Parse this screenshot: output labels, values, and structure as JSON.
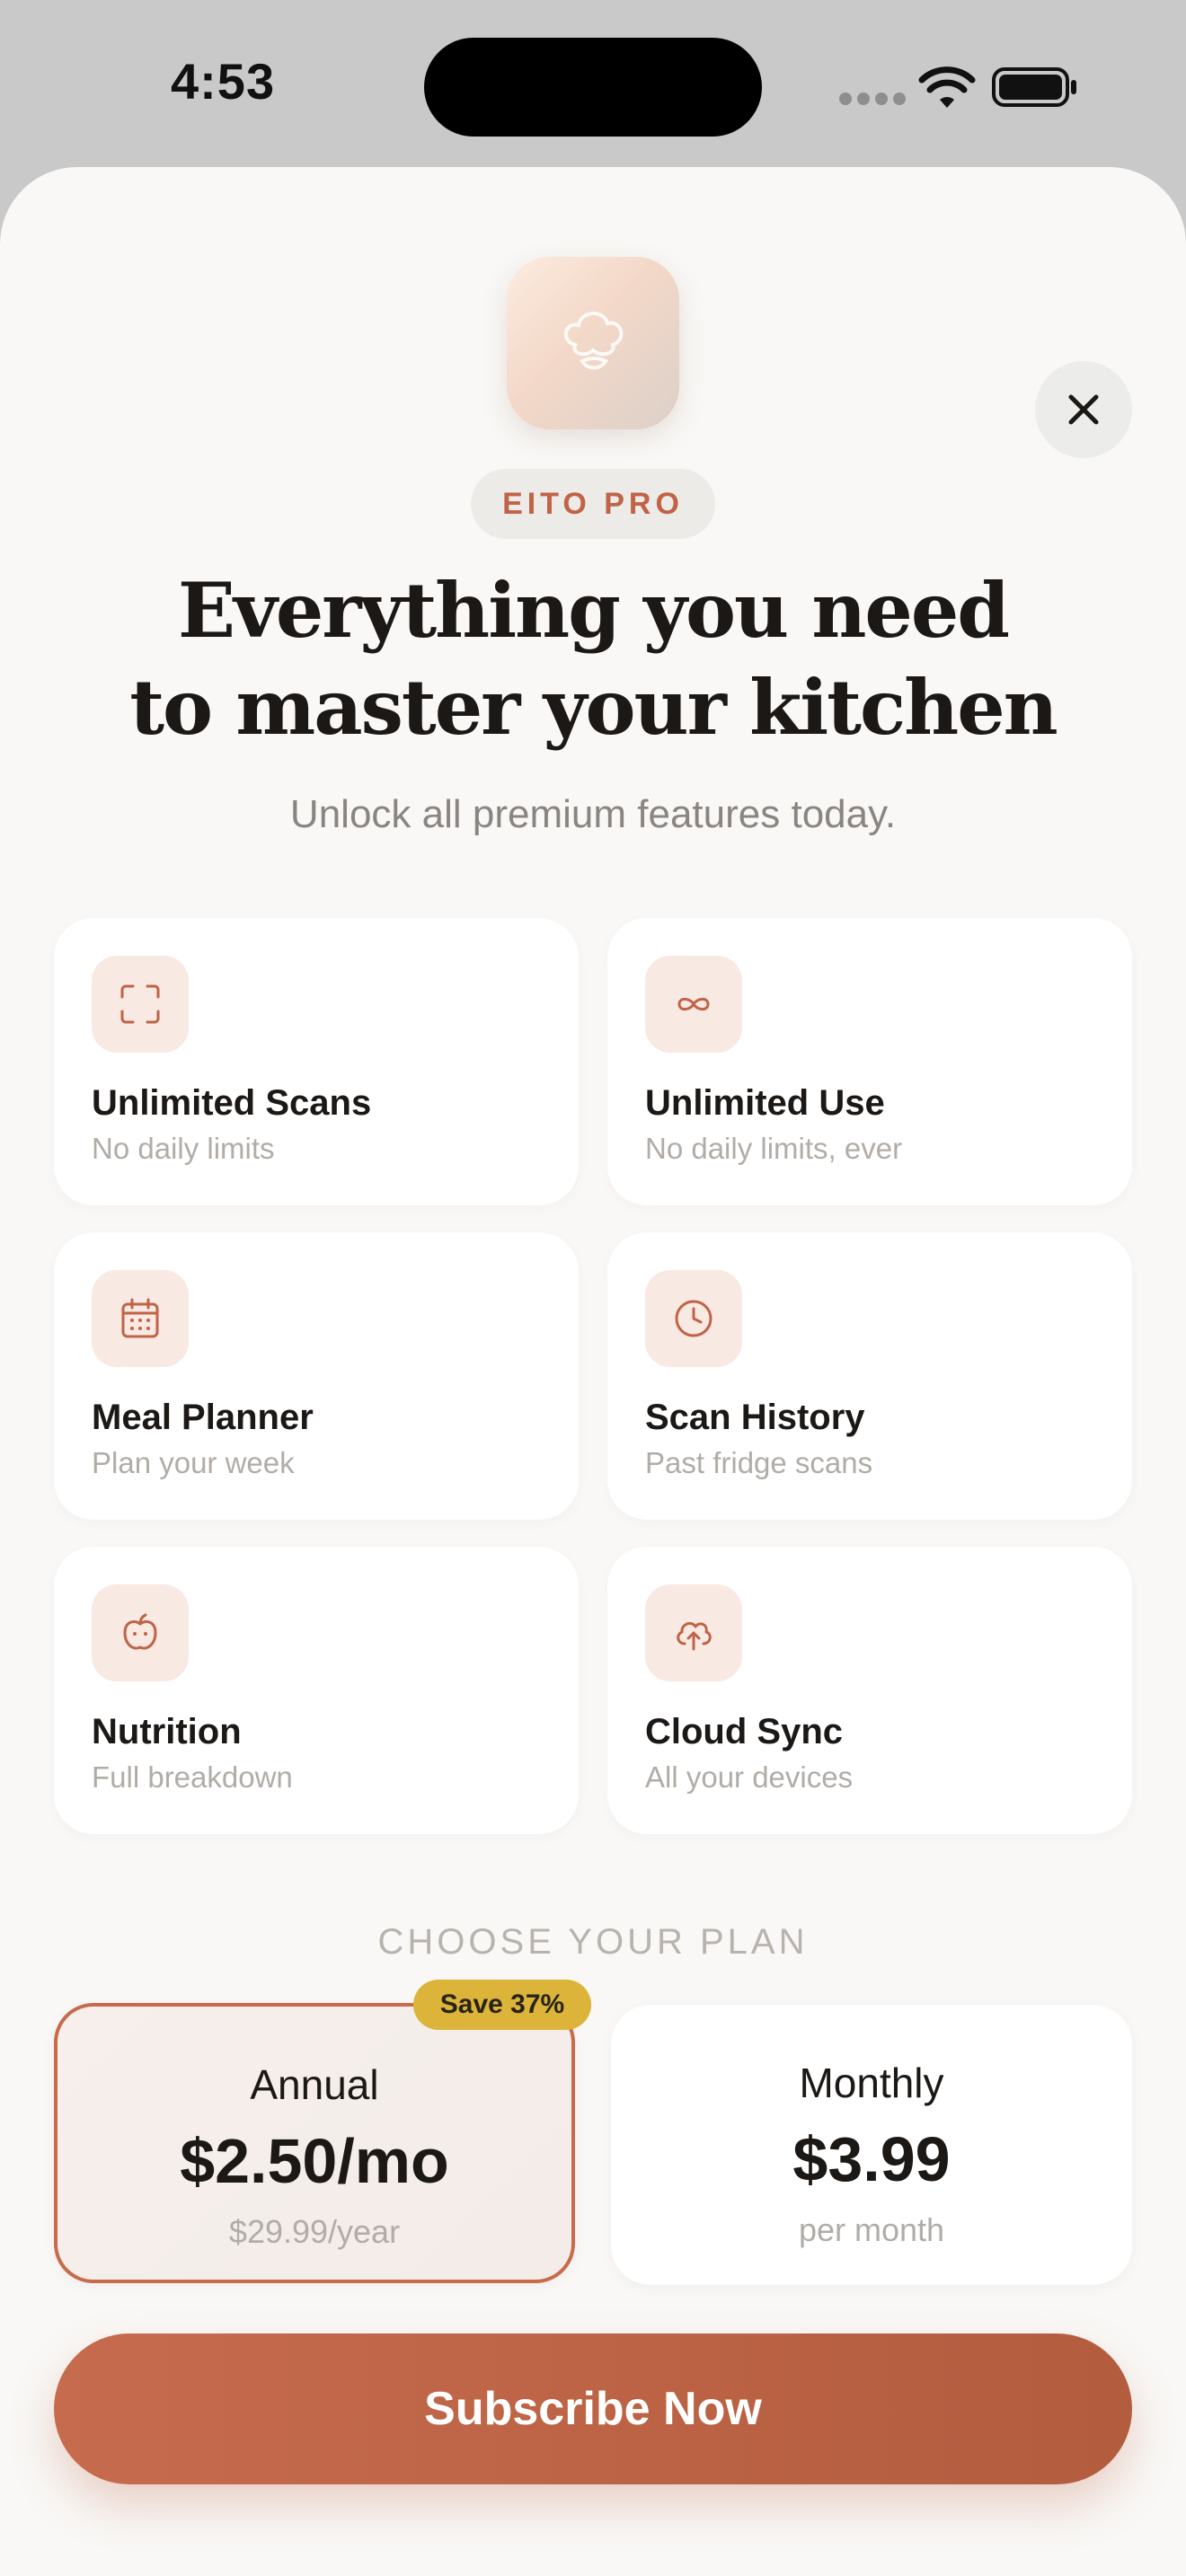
{
  "status_bar": {
    "time": "4:53"
  },
  "header": {
    "badge": "EITO PRO",
    "headline_line1": "Everything you need",
    "headline_line2": "to master your kitchen",
    "subheadline": "Unlock all premium features today."
  },
  "features": [
    {
      "title": "Unlimited Scans",
      "desc": "No daily limits",
      "icon": "scan-frame-icon"
    },
    {
      "title": "Unlimited Use",
      "desc": "No daily limits, ever",
      "icon": "infinity-icon"
    },
    {
      "title": "Meal Planner",
      "desc": "Plan your week",
      "icon": "calendar-icon"
    },
    {
      "title": "Scan History",
      "desc": "Past fridge scans",
      "icon": "clock-icon"
    },
    {
      "title": "Nutrition",
      "desc": "Full breakdown",
      "icon": "apple-icon"
    },
    {
      "title": "Cloud Sync",
      "desc": "All your devices",
      "icon": "cloud-upload-icon"
    }
  ],
  "plans": {
    "section_label": "CHOOSE YOUR PLAN",
    "annual": {
      "name": "Annual",
      "price": "$2.50/mo",
      "note": "$29.99/year",
      "badge": "Save 37%",
      "selected": true
    },
    "monthly": {
      "name": "Monthly",
      "price": "$3.99",
      "note": "per month",
      "selected": false
    }
  },
  "cta": {
    "label": "Subscribe Now"
  },
  "colors": {
    "accent": "#c06347",
    "cta_start": "#c76b4e",
    "cta_end": "#b35c3e",
    "save_badge": "#dcb43a",
    "sheet_background": "#f9f8f6"
  }
}
